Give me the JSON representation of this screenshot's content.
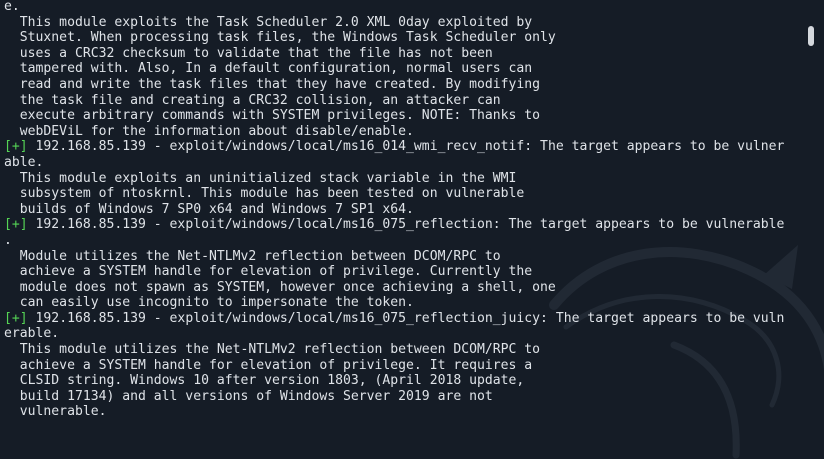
{
  "terminal": {
    "lines": [
      {
        "text": "e."
      },
      {
        "text": "  This module exploits the Task Scheduler 2.0 XML 0day exploited by"
      },
      {
        "text": "  Stuxnet. When processing task files, the Windows Task Scheduler only"
      },
      {
        "text": "  uses a CRC32 checksum to validate that the file has not been"
      },
      {
        "text": "  tampered with. Also, In a default configuration, normal users can"
      },
      {
        "text": "  read and write the task files that they have created. By modifying"
      },
      {
        "text": "  the task file and creating a CRC32 collision, an attacker can"
      },
      {
        "text": "  execute arbitrary commands with SYSTEM privileges. NOTE: Thanks to"
      },
      {
        "text": "  webDEViL for the information about disable/enable."
      },
      {
        "prefix": "[+]",
        "text": " 192.168.85.139 - exploit/windows/local/ms16_014_wmi_recv_notif: The target appears to be vulner"
      },
      {
        "text": "able."
      },
      {
        "text": "  This module exploits an uninitialized stack variable in the WMI"
      },
      {
        "text": "  subsystem of ntoskrnl. This module has been tested on vulnerable"
      },
      {
        "text": "  builds of Windows 7 SP0 x64 and Windows 7 SP1 x64."
      },
      {
        "prefix": "[+]",
        "text": " 192.168.85.139 - exploit/windows/local/ms16_075_reflection: The target appears to be vulnerable"
      },
      {
        "text": "."
      },
      {
        "text": "  Module utilizes the Net-NTLMv2 reflection between DCOM/RPC to"
      },
      {
        "text": "  achieve a SYSTEM handle for elevation of privilege. Currently the"
      },
      {
        "text": "  module does not spawn as SYSTEM, however once achieving a shell, one"
      },
      {
        "text": "  can easily use incognito to impersonate the token."
      },
      {
        "prefix": "[+]",
        "text": " 192.168.85.139 - exploit/windows/local/ms16_075_reflection_juicy: The target appears to be vuln"
      },
      {
        "text": "erable."
      },
      {
        "text": "  This module utilizes the Net-NTLMv2 reflection between DCOM/RPC to"
      },
      {
        "text": "  achieve a SYSTEM handle for elevation of privilege. It requires a"
      },
      {
        "text": "  CLSID string. Windows 10 after version 1803, (April 2018 update,"
      },
      {
        "text": "  build 17134) and all versions of Windows Server 2019 are not"
      },
      {
        "text": "  vulnerable."
      }
    ]
  },
  "colors": {
    "background": "#151c26",
    "text": "#dfe3e8",
    "success_prefix": "#55d455"
  },
  "icons": {
    "watermark": "kali-dragon-icon"
  }
}
